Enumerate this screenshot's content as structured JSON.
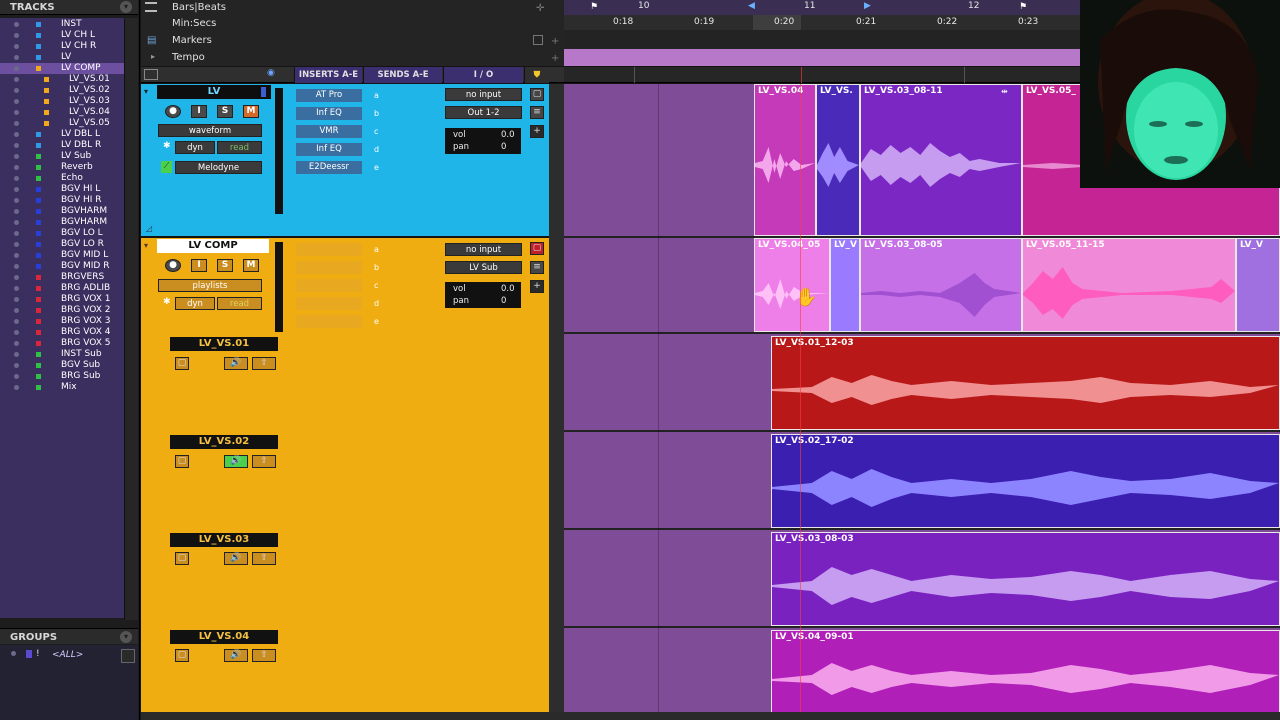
{
  "tracks_panel": {
    "title": "TRACKS",
    "items": [
      {
        "label": "INST",
        "color": "#2f9be6"
      },
      {
        "label": "LV CH L",
        "color": "#2f9be6"
      },
      {
        "label": "LV CH R",
        "color": "#2f9be6"
      },
      {
        "label": "LV",
        "color": "#2f9be6"
      },
      {
        "label": "LV COMP",
        "color": "#f2a81d"
      },
      {
        "label": "LV_VS.01",
        "color": "#f2a81d"
      },
      {
        "label": "LV_VS.02",
        "color": "#f2a81d"
      },
      {
        "label": "LV_VS.03",
        "color": "#f2a81d"
      },
      {
        "label": "LV_VS.04",
        "color": "#f2a81d"
      },
      {
        "label": "LV_VS.05",
        "color": "#f2a81d"
      },
      {
        "label": "LV DBL L",
        "color": "#2f9be6"
      },
      {
        "label": "LV DBL R",
        "color": "#2f9be6"
      },
      {
        "label": "LV Sub",
        "color": "#2fc04a"
      },
      {
        "label": "Reverb",
        "color": "#2fc04a"
      },
      {
        "label": "Echo",
        "color": "#2fc04a"
      },
      {
        "label": "BGV HI L",
        "color": "#2a3fd8"
      },
      {
        "label": "BGV HI R",
        "color": "#2a3fd8"
      },
      {
        "label": "BGVHARM",
        "color": "#2a3fd8"
      },
      {
        "label": "BGVHARM",
        "color": "#2a3fd8"
      },
      {
        "label": "BGV LO L",
        "color": "#2a3fd8"
      },
      {
        "label": "BGV LO R",
        "color": "#2a3fd8"
      },
      {
        "label": "BGV MID L",
        "color": "#2a3fd8"
      },
      {
        "label": "BGV MID R",
        "color": "#2a3fd8"
      },
      {
        "label": "BRGVERS",
        "color": "#d8263a"
      },
      {
        "label": "BRG ADLIB",
        "color": "#d8263a"
      },
      {
        "label": "BRG VOX 1",
        "color": "#d8263a"
      },
      {
        "label": "BRG VOX 2",
        "color": "#d8263a"
      },
      {
        "label": "BRG VOX 3",
        "color": "#d8263a"
      },
      {
        "label": "BRG VOX 4",
        "color": "#d8263a"
      },
      {
        "label": "BRG VOX 5",
        "color": "#d8263a"
      },
      {
        "label": "INST Sub",
        "color": "#2fc04a"
      },
      {
        "label": "BGV Sub",
        "color": "#2fc04a"
      },
      {
        "label": "BRG Sub",
        "color": "#2fc04a"
      },
      {
        "label": "Mix",
        "color": "#2fc04a"
      }
    ]
  },
  "groups_panel": {
    "title": "GROUPS",
    "all_label": "<ALL>"
  },
  "rulers": {
    "bars_beats": "Bars|Beats",
    "min_secs": "Min:Secs",
    "markers": "Markers",
    "tempo": "Tempo",
    "bar_ticks": [
      "10",
      "11",
      "12"
    ],
    "time_ticks": [
      "0:18",
      "0:19",
      "0:20",
      "0:21",
      "0:22",
      "0:23"
    ]
  },
  "edit_header": {
    "inserts": "INSERTS A-E",
    "sends": "SENDS A-E",
    "io": "I / O"
  },
  "tracks": {
    "lv": {
      "name": "LV",
      "view": "waveform",
      "automation": "dyn",
      "automation_mode": "read",
      "plugin": "Melodyne",
      "inserts": [
        "AT Pro",
        "Inf EQ",
        "VMR",
        "Inf EQ",
        "E2Deessr"
      ],
      "send_letters": [
        "a",
        "b",
        "c",
        "d",
        "e"
      ],
      "input": "no input",
      "output": "Out 1-2",
      "vol_label": "vol",
      "vol": "0.0",
      "pan_label": "pan",
      "pan": "0",
      "buttons": {
        "solo": "S",
        "mute": "M",
        "input": "I"
      }
    },
    "lv_comp": {
      "name": "LV COMP",
      "view": "playlists",
      "automation": "dyn",
      "automation_mode": "read",
      "send_letters": [
        "a",
        "b",
        "c",
        "d",
        "e"
      ],
      "input": "no input",
      "output": "LV Sub",
      "vol_label": "vol",
      "vol": "0.0",
      "pan_label": "pan",
      "pan": "0",
      "buttons": {
        "solo": "S",
        "mute": "M",
        "input": "I"
      }
    },
    "playlists": [
      {
        "name": "LV_VS.01",
        "speaker_active": false
      },
      {
        "name": "LV_VS.02",
        "speaker_active": true
      },
      {
        "name": "LV_VS.03",
        "speaker_active": false
      },
      {
        "name": "LV_VS.04",
        "speaker_active": false
      }
    ]
  },
  "clips": {
    "lv": [
      "LV_VS.04",
      "LV_VS.",
      "LV_VS.03_08-11",
      "LV_VS.05_"
    ],
    "lv_comp": [
      "LV_VS.04_05",
      "LV_V",
      "LV_VS.03_08-05",
      "LV_VS.05_11-15",
      "LV_V"
    ],
    "playlists": [
      "LV_VS.01_12-03",
      "LV_VS.02_17-02",
      "LV_VS.03_08-03",
      "LV_VS.04_09-01"
    ]
  },
  "colors": {
    "lv_track": "#1fb5e8",
    "comp_track": "#f0ad12",
    "clip_red": "#b81818",
    "clip_blue": "#3a1fb0",
    "clip_purple": "#7a22c0",
    "clip_magenta": "#b01fb8",
    "clip_pink": "#e872d8"
  }
}
